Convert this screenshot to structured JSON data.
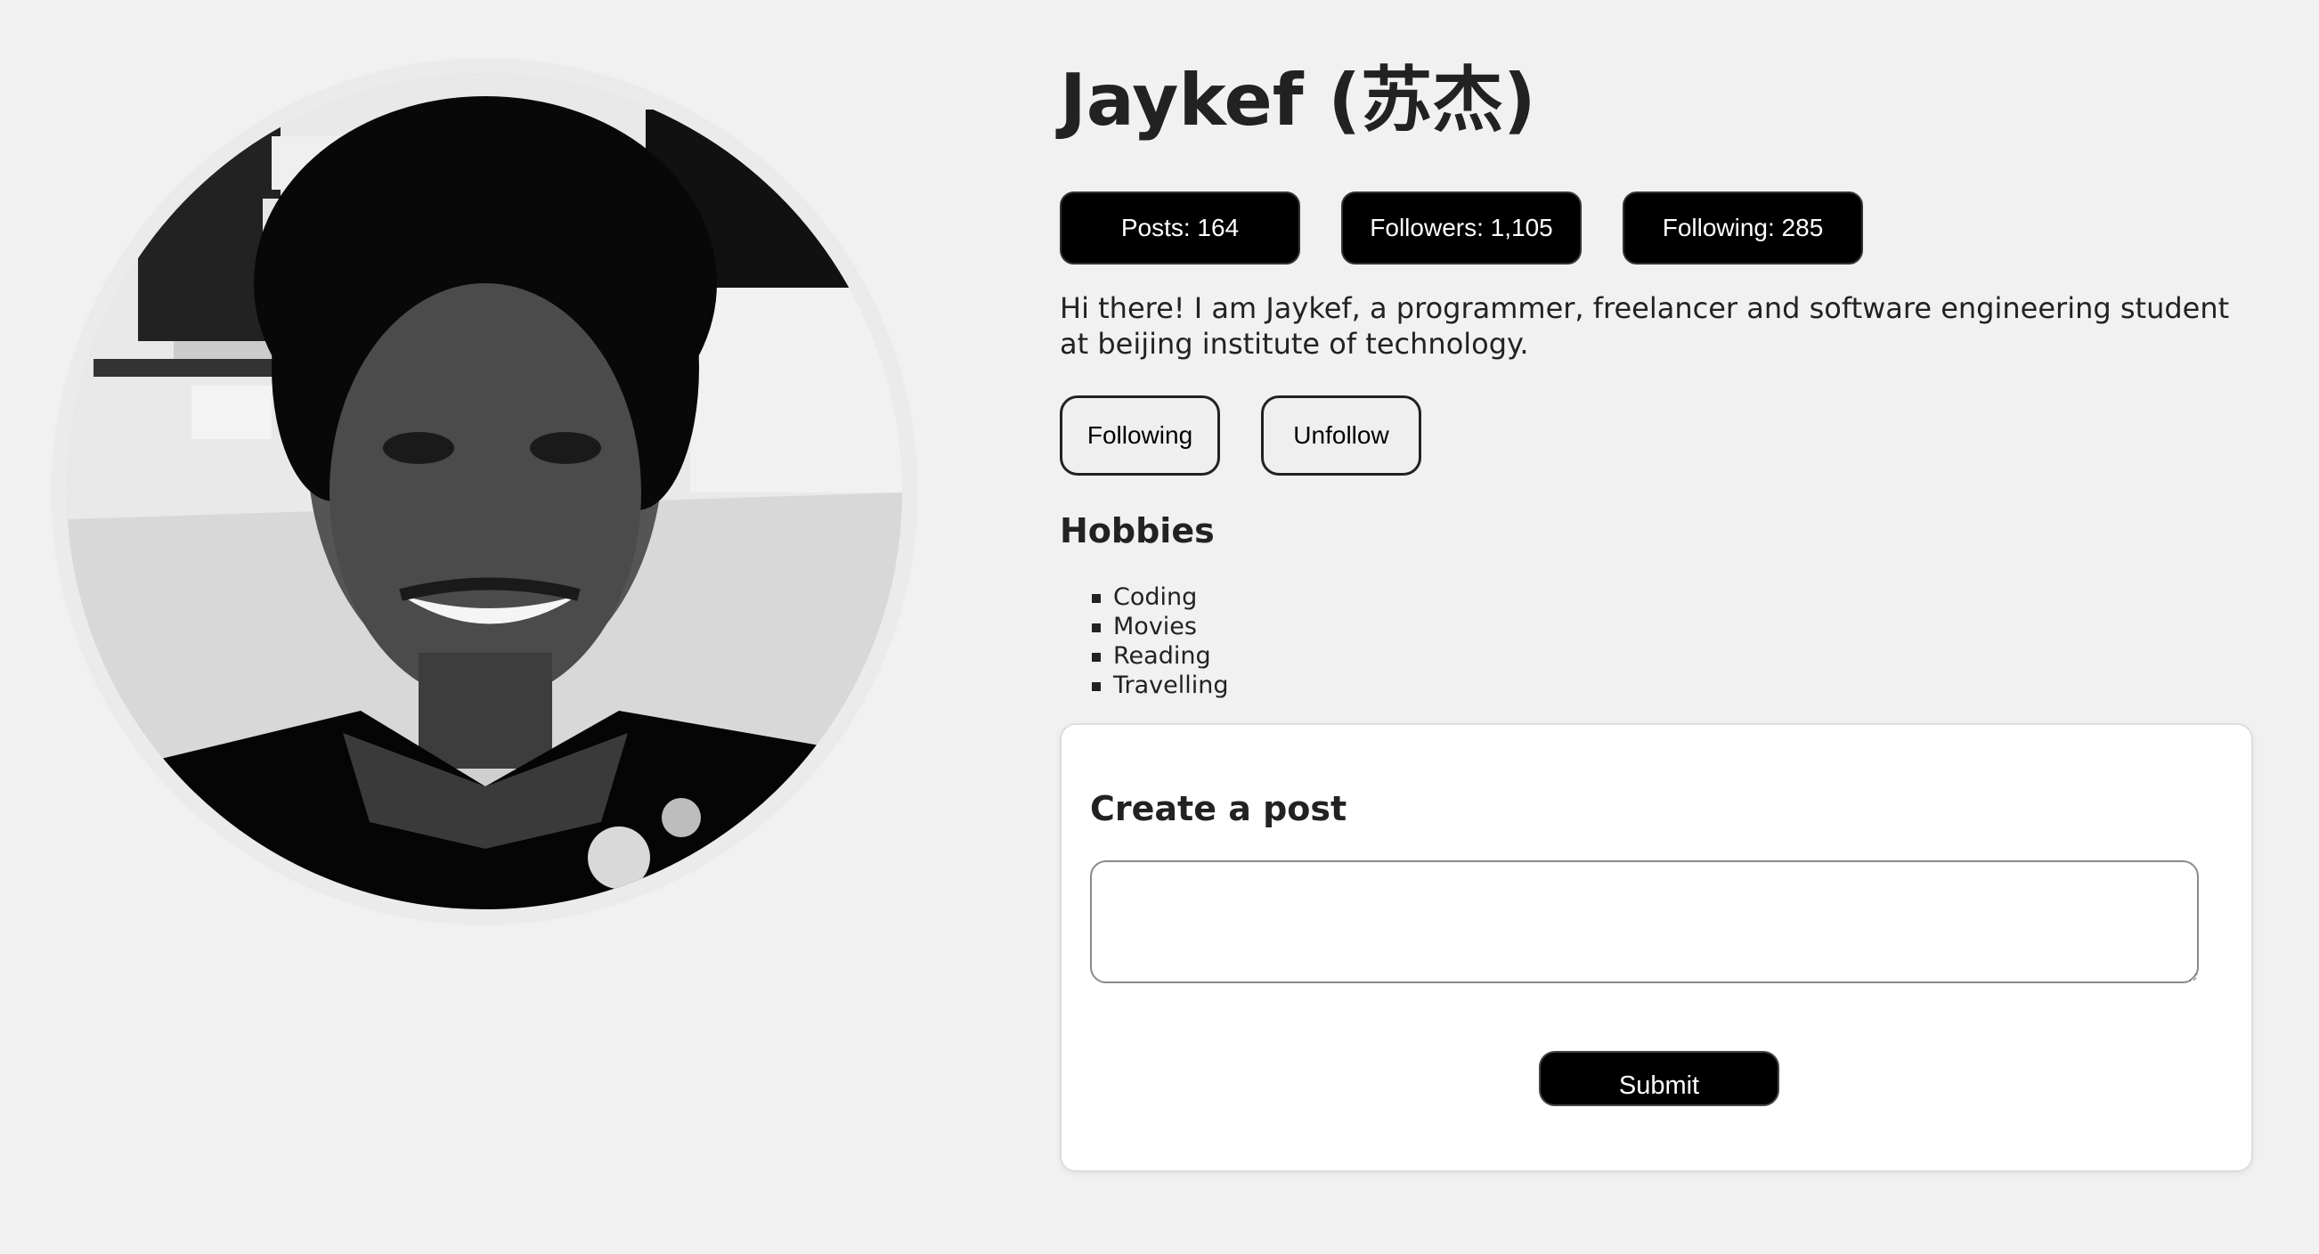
{
  "profile": {
    "name": "Jaykef (苏杰)",
    "avatar_icon": "profile-photo",
    "bio": "Hi there! I am Jaykef, a programmer, freelancer and software engineering student at beijing institute of technology."
  },
  "stats": {
    "posts": "Posts: 164",
    "followers": "Followers: 1,105",
    "following": "Following: 285"
  },
  "actions": {
    "following_label": "Following",
    "unfollow_label": "Unfollow"
  },
  "hobbies": {
    "title": "Hobbies",
    "items": [
      "Coding",
      "Movies",
      "Reading",
      "Travelling"
    ]
  },
  "post": {
    "title": "Create a post",
    "placeholder": "",
    "submit_label": "Submit"
  },
  "colors": {
    "page_background": "#f1f1f1",
    "primary_button": "#000000",
    "primary_button_text": "#ffffff",
    "text": "#222222",
    "card_background": "#ffffff"
  }
}
